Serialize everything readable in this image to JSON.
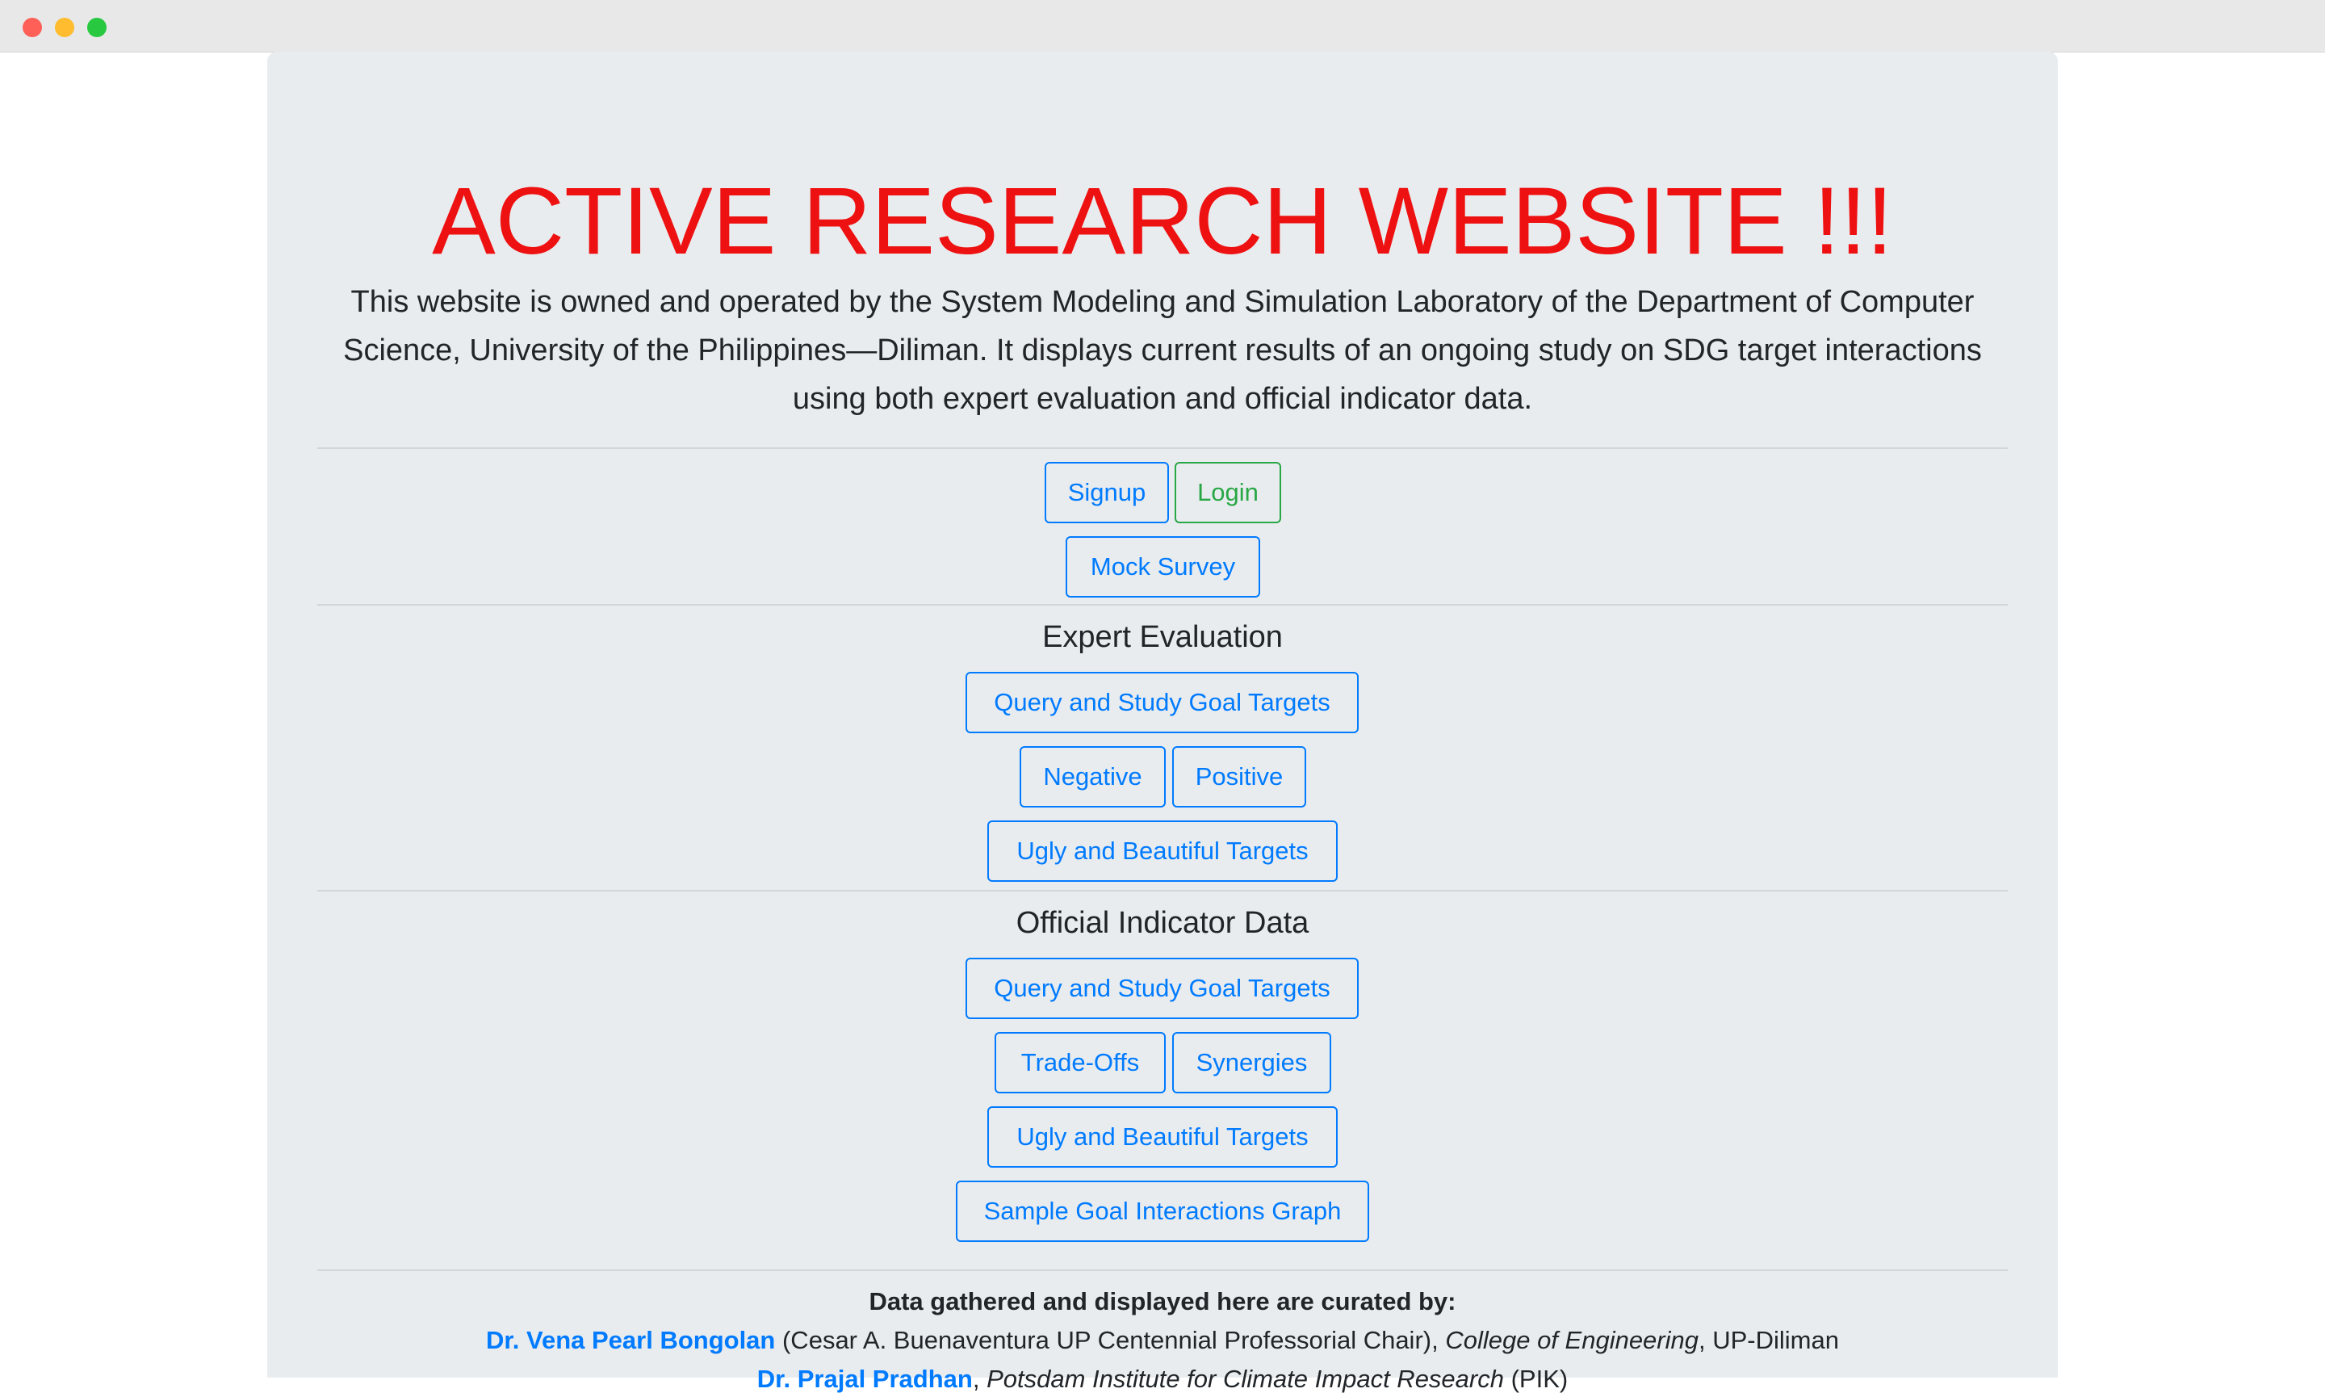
{
  "page": {
    "title": "ACTIVE RESEARCH WEBSITE !!!",
    "lead": "This website is owned and operated by the System Modeling and Simulation Laboratory of the Department of Computer Science, University of the Philippines—Diliman. It displays current results of an ongoing study on SDG target interactions using both expert evaluation and official indicator data."
  },
  "auth": {
    "signup": "Signup",
    "login": "Login",
    "mock_survey": "Mock Survey"
  },
  "expert_evaluation": {
    "heading": "Expert Evaluation",
    "query": "Query and Study Goal Targets",
    "negative": "Negative",
    "positive": "Positive",
    "ugly_beautiful": "Ugly and Beautiful Targets"
  },
  "official_indicator": {
    "heading": "Official Indicator Data",
    "query": "Query and Study Goal Targets",
    "trade_offs": "Trade-Offs",
    "synergies": "Synergies",
    "ugly_beautiful": "Ugly and Beautiful Targets",
    "sample_graph": "Sample Goal Interactions Graph"
  },
  "credits": {
    "heading": "Data gathered and displayed here are curated by:",
    "curator1": {
      "name": "Dr. Vena Pearl Bongolan",
      "role": " (Cesar A. Buenaventura UP Centennial Professorial Chair), ",
      "college": "College of Engineering",
      "campus": ", UP-Diliman"
    },
    "curator2": {
      "name": "Dr. Prajal Pradhan",
      "separator": ", ",
      "institute": "Potsdam Institute for Climate Impact Research",
      "abbr": " (PIK)"
    }
  },
  "colors": {
    "title": "#ee1111",
    "primary": "#007bff",
    "success": "#28a745",
    "panel": "#e9ecef"
  }
}
